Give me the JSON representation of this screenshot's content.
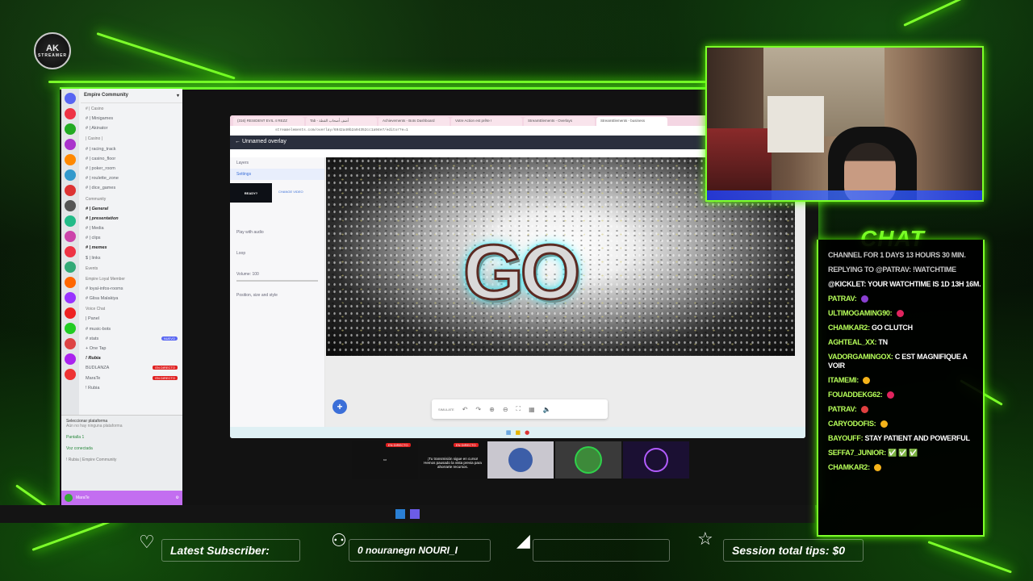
{
  "logo": {
    "text": "AK",
    "sub": "STREAMER"
  },
  "discord": {
    "server_name": "Empire Community",
    "channels": [
      {
        "label": "# | Casino",
        "style": "cat"
      },
      {
        "label": "# | Minigames"
      },
      {
        "label": "# | Akinator"
      },
      {
        "label": "| Casino |",
        "style": "cat"
      },
      {
        "label": "# | racing_track"
      },
      {
        "label": "# | casino_floor"
      },
      {
        "label": "# | poker_room"
      },
      {
        "label": "# | roulette_zone"
      },
      {
        "label": "# | dice_games"
      },
      {
        "label": "Community",
        "style": "cat"
      },
      {
        "label": "# | General",
        "style": "bold"
      },
      {
        "label": "# | presentation",
        "style": "bold"
      },
      {
        "label": "# | Media"
      },
      {
        "label": "# | clips"
      },
      {
        "label": "# | memes",
        "style": "bold"
      },
      {
        "label": "$ | links"
      },
      {
        "label": "Events",
        "style": "cat"
      },
      {
        "label": "Empire Loyal Member",
        "style": "cat"
      },
      {
        "label": "# loyal-infos-rooms"
      },
      {
        "label": "# Glisa Malakiya"
      },
      {
        "label": "Voice Chat",
        "style": "cat"
      },
      {
        "label": "| Panel"
      },
      {
        "label": "# music-bots"
      },
      {
        "label": "# stats",
        "badge": "NUEVO"
      },
      {
        "label": "+ One Tap"
      },
      {
        "label": "! Rubia",
        "style": "bold"
      },
      {
        "label": "BUDLANZA",
        "live": "EN DIRECTO"
      },
      {
        "label": "MaraTe",
        "live": "EN DIRECTO"
      },
      {
        "label": "! Rubia"
      }
    ],
    "platform_label": "Seleccionar plataforma",
    "platform_sub": "Aún no hay ninguna plataforma",
    "screen_label": "Pantalla 1",
    "voice_connected": "Voz conectada",
    "voice_channel": "! Rubia | Empire Community",
    "user_name": "MaraTe"
  },
  "browser": {
    "tabs": [
      "(316) RESIDENT EVIL 4 REZZ",
      "Tab - أضف أصحاب القطة",
      "Achievements - Bots Dashboard",
      "Votre Action est prête !",
      "StreamElements - Overlays",
      "StreamElements - business"
    ],
    "address": "streamelements.com/overlay/6942a40b2a94352cc1a94e7/editor?e=1",
    "header_title": "Unnamed overlay",
    "left_items": [
      "Layers",
      "Settings"
    ],
    "thumb_label": "READY?",
    "change_video": "CHANGE VIDEO",
    "play_audio": "Play with audio",
    "loop": "Loop",
    "volume": "Volume: 100",
    "position": "Position, size and style",
    "go_text": "GO",
    "plus": "+",
    "simulate": "SIMULATE"
  },
  "tiles": [
    {
      "live": "EN DIRECTO",
      "text": ""
    },
    {
      "live": "EN DIRECTO",
      "text": "¡Tu transmisión sigue en curso! Hemos pausado la vista previa para ahorrarte recursos."
    }
  ],
  "chat": {
    "title": "CHAT",
    "lines": [
      {
        "user": "",
        "text": "CHANNEL FOR 1 DAYS 13 HOURS 30 MIN.",
        "system": true
      },
      {
        "user": "",
        "text": "REPLYING TO @PATRAV: !WATCHTIME",
        "system": true
      },
      {
        "user": "",
        "text": "@KICKLET: YOUR WATCHTIME IS 1D 13H 16M.",
        "system": false
      },
      {
        "user": "PATRAV:",
        "text": "",
        "emote": "#8a3fd1"
      },
      {
        "user": "ULTIMOGAMING90:",
        "text": "",
        "emote": "#e0245e"
      },
      {
        "user": "CHAMKAR2:",
        "text": "GO CLUTCH"
      },
      {
        "user": "AGHTEAL_XX:",
        "text": "TN"
      },
      {
        "user": "VADORGAMINGOX:",
        "text": "C EST MAGNIFIQUE A VOIR"
      },
      {
        "user": "ITAMEMI:",
        "text": "",
        "emote": "#f5b31a"
      },
      {
        "user": "FOUADDEKG62:",
        "text": "",
        "emote": "#e0245e"
      },
      {
        "user": "PATRAV:",
        "text": "",
        "emote": "#e04040"
      },
      {
        "user": "CARYODOFIS:",
        "text": "",
        "emote": "#f5b31a"
      },
      {
        "user": "BAYOUFF:",
        "text": "STAY PATIENT AND POWERFUL"
      },
      {
        "user": "SEFFA7_JUNIOR:",
        "text": "✅ ✅ ✅"
      },
      {
        "user": "CHAMKAR2:",
        "text": "",
        "emote": "#f5b31a"
      }
    ]
  },
  "bottom": {
    "latest_subscriber": "Latest Subscriber:",
    "subscriber_names": "0   nouranegn   NOURI_I",
    "session_tips": "Session total tips: $0"
  },
  "colors": {
    "neon": "#7dff2a",
    "accent": "#3b6fd8"
  }
}
